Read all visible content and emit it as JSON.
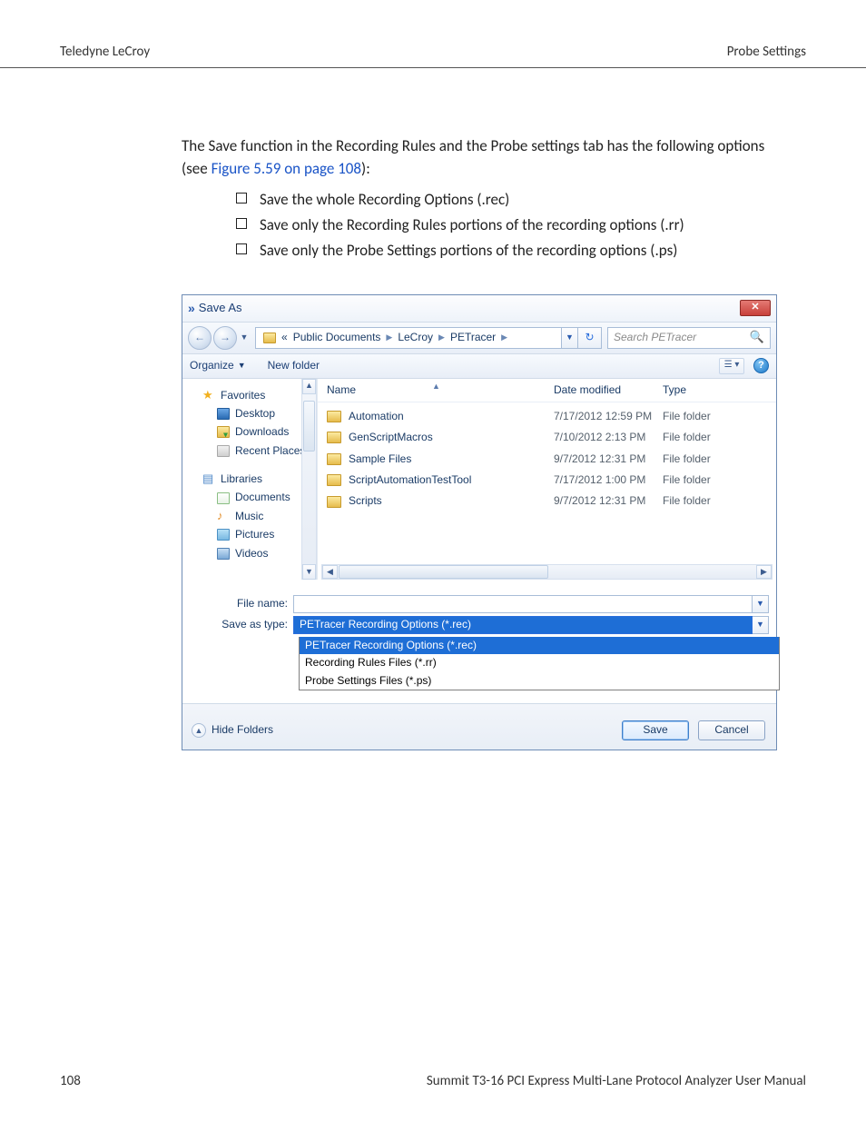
{
  "header": {
    "left": "Teledyne LeCroy",
    "right": "Probe Settings"
  },
  "intro": {
    "p1a": "The Save function in the Recording Rules and the Probe settings tab has the following options (see ",
    "link": "Figure 5.59 on page 108",
    "p1b": "):"
  },
  "bullets": [
    "Save the whole Recording Options (.rec)",
    "Save only the Recording Rules portions of the recording options (.rr)",
    "Save only the Probe Settings portions of the recording options (.ps)"
  ],
  "dialog": {
    "title": "Save As",
    "breadcrumbs": [
      "Public Documents",
      "LeCroy",
      "PETracer"
    ],
    "search_placeholder": "Search PETracer",
    "toolbar": {
      "organize": "Organize",
      "new_folder": "New folder"
    },
    "nav": {
      "favorites": "Favorites",
      "fav_items": [
        "Desktop",
        "Downloads",
        "Recent Places"
      ],
      "libraries": "Libraries",
      "lib_items": [
        "Documents",
        "Music",
        "Pictures",
        "Videos"
      ]
    },
    "columns": {
      "name": "Name",
      "date": "Date modified",
      "type": "Type"
    },
    "rows": [
      {
        "name": "Automation",
        "date": "7/17/2012 12:59 PM",
        "type": "File folder"
      },
      {
        "name": "GenScriptMacros",
        "date": "7/10/2012 2:13 PM",
        "type": "File folder"
      },
      {
        "name": "Sample Files",
        "date": "9/7/2012 12:31 PM",
        "type": "File folder"
      },
      {
        "name": "ScriptAutomationTestTool",
        "date": "7/17/2012 1:00 PM",
        "type": "File folder"
      },
      {
        "name": "Scripts",
        "date": "9/7/2012 12:31 PM",
        "type": "File folder"
      }
    ],
    "file_name_label": "File name:",
    "save_type_label": "Save as type:",
    "save_type_value": "PETracer Recording Options (*.rec)",
    "type_options": [
      "PETracer Recording Options (*.rec)",
      "Recording Rules Files (*.rr)",
      "Probe Settings Files (*.ps)"
    ],
    "hide_folders": "Hide Folders",
    "save_btn": "Save",
    "cancel_btn": "Cancel"
  },
  "footer": {
    "page": "108",
    "title": "Summit T3-16 PCI Express Multi-Lane Protocol Analyzer User Manual"
  }
}
